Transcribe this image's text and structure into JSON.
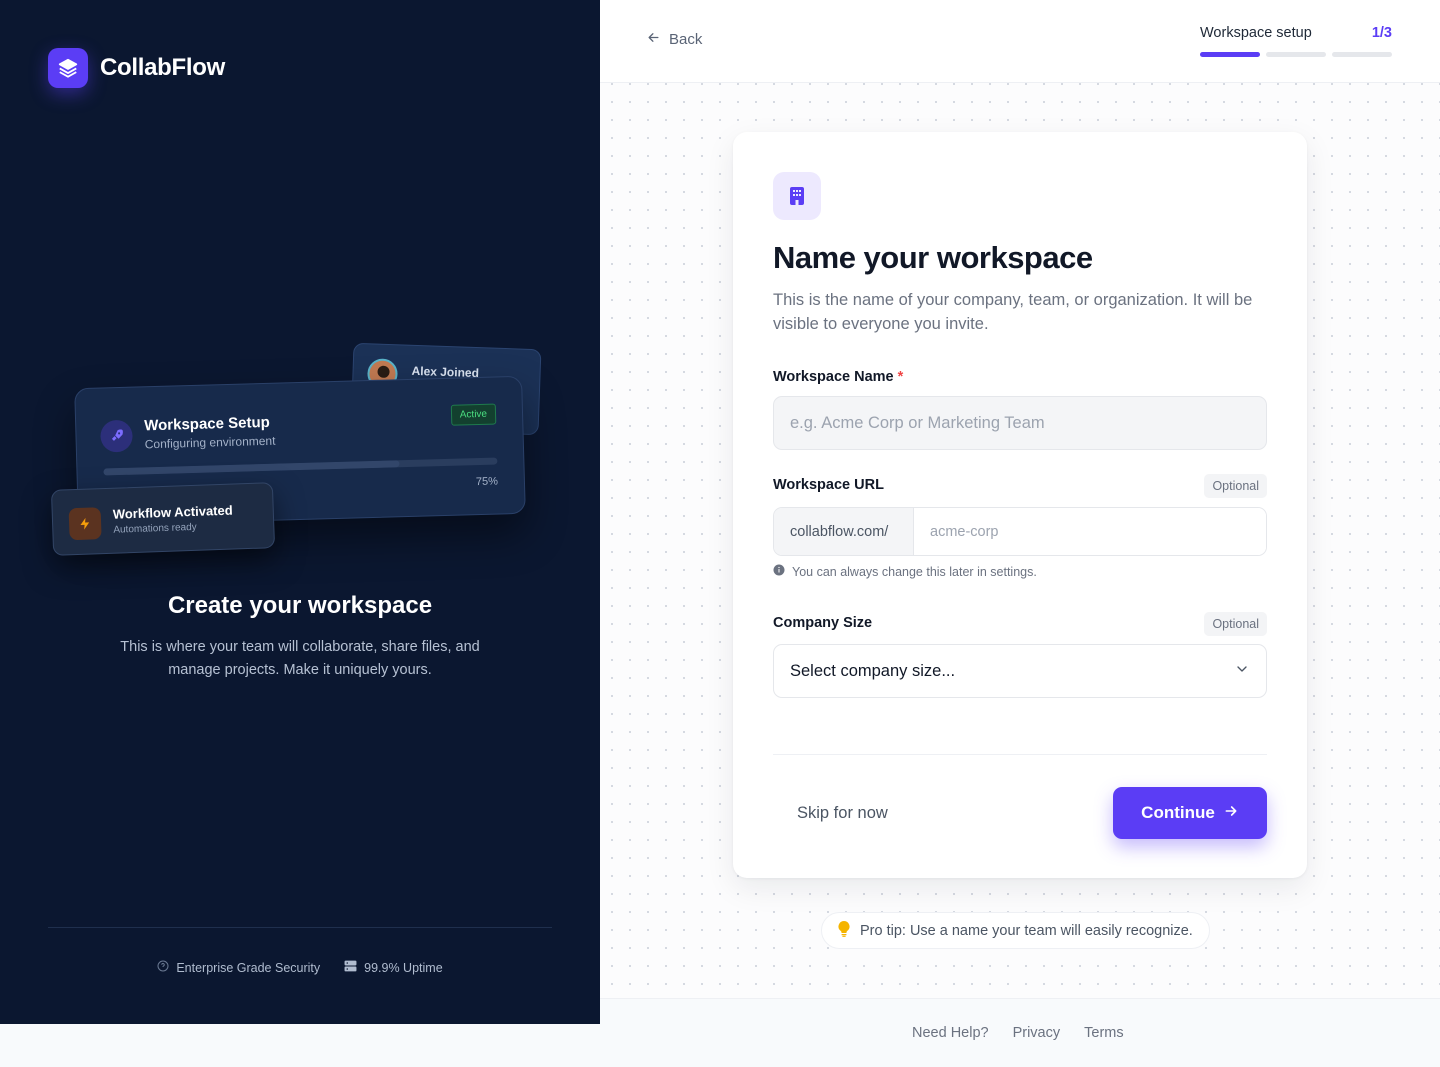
{
  "brand": {
    "name": "CollabFlow",
    "accent": "#5b3df5",
    "logo_icon": "layers-icon"
  },
  "illustration": {
    "notification": {
      "text": "Alex Joined"
    },
    "setup_card": {
      "title": "Workspace Setup",
      "subtitle": "Configuring environment",
      "status": "Active",
      "progress": 0.75,
      "progress_label": "75%",
      "icon": "rocket-icon"
    },
    "workflow_card": {
      "title": "Workflow Activated",
      "subtitle": "Automations ready",
      "icon": "lightning-icon"
    }
  },
  "left": {
    "title": "Create your workspace",
    "description": "This is where your team will collaborate, share files, and manage projects. Make it uniquely yours.",
    "features": [
      {
        "label": "Enterprise Grade Security",
        "icon": "shield-icon"
      },
      {
        "label": "99.9% Uptime",
        "icon": "server-icon"
      }
    ]
  },
  "header": {
    "back_label": "Back",
    "step_label": "Workspace setup",
    "step_count": "1/3",
    "current_step": 1,
    "total_steps": 3
  },
  "form": {
    "icon": "building-icon",
    "title": "Name your workspace",
    "description": "This is the name of your company, team, or organization. It will be visible to everyone you invite.",
    "name_field": {
      "label": "Workspace Name",
      "required_mark": "*",
      "placeholder": "e.g. Acme Corp or Marketing Team",
      "value": ""
    },
    "url_field": {
      "label": "Workspace URL",
      "optional_label": "Optional",
      "prefix": "collabflow.com/",
      "placeholder": "acme-corp",
      "value": "",
      "hint": "You can always change this later in settings."
    },
    "size_field": {
      "label": "Company Size",
      "optional_label": "Optional",
      "selected": "Select company size..."
    },
    "skip_label": "Skip for now",
    "continue_label": "Continue"
  },
  "tip": {
    "text": "Pro tip: Use a name your team will easily recognize.",
    "icon": "lightbulb-icon"
  },
  "footer": {
    "links": [
      "Need Help?",
      "Privacy",
      "Terms"
    ]
  }
}
